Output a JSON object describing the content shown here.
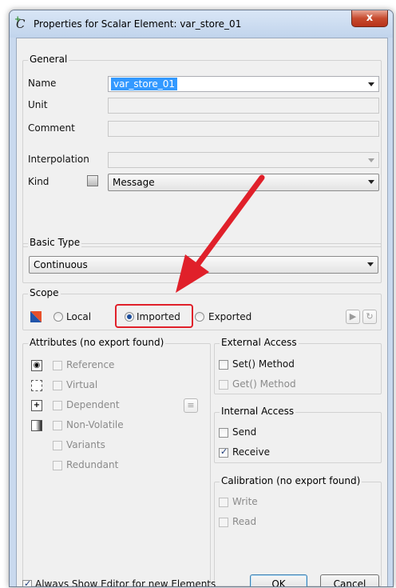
{
  "window": {
    "title": "Properties for Scalar Element: var_store_01",
    "close_glyph": "x"
  },
  "general": {
    "legend": "General",
    "name_label": "Name",
    "name_value": "var_store_01",
    "unit_label": "Unit",
    "comment_label": "Comment",
    "interpolation_label": "Interpolation",
    "kind_label": "Kind",
    "kind_value": "Message"
  },
  "basic_type": {
    "legend": "Basic Type",
    "value": "Continuous"
  },
  "scope": {
    "legend": "Scope",
    "local": "Local",
    "imported": "Imported",
    "exported": "Exported",
    "selected": "Imported"
  },
  "attributes": {
    "legend": "Attributes (no export found)",
    "items": [
      "Reference",
      "Virtual",
      "Dependent",
      "Non-Volatile",
      "Variants",
      "Redundant"
    ]
  },
  "external_access": {
    "legend": "External Access",
    "set_method": "Set() Method",
    "get_method": "Get() Method"
  },
  "internal_access": {
    "legend": "Internal Access",
    "send": "Send",
    "receive": "Receive"
  },
  "calibration": {
    "legend": "Calibration (no export found)",
    "write": "Write",
    "read": "Read"
  },
  "footer": {
    "always_show": "Always Show Editor for new Elements",
    "ok": "OK",
    "cancel": "Cancel"
  },
  "colors": {
    "annotation_red": "#e0202a",
    "selection_blue": "#3399ff"
  }
}
